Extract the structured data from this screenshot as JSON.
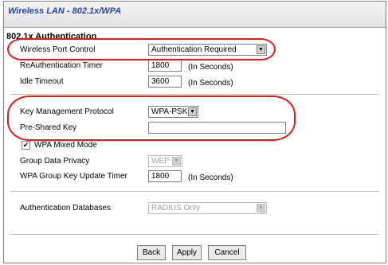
{
  "window": {
    "title": "Wireless LAN - 802.1x/WPA"
  },
  "auth": {
    "heading": "802.1x Authentication",
    "port_control_label": "Wireless Port Control",
    "port_control_value": "Authentication Required",
    "reauth_label": "ReAuthentication Timer",
    "reauth_value": "1800",
    "reauth_unit": "(In Seconds)",
    "idle_label": "Idle Timeout",
    "idle_value": "3600",
    "idle_unit": "(In Seconds)"
  },
  "wpa": {
    "key_mgmt_label": "Key Management Protocol",
    "key_mgmt_value": "WPA-PSK",
    "psk_label": "Pre-Shared Key",
    "psk_value": "",
    "mixed_mode_label": "WPA Mixed Mode",
    "mixed_mode_checked": true,
    "group_privacy_label": "Group Data Privacy",
    "group_privacy_value": "WEP",
    "group_key_label": "WPA Group Key Update Timer",
    "group_key_value": "1800",
    "group_key_unit": "(In Seconds)"
  },
  "database": {
    "label": "Authentication Databases",
    "value": "RADIUS Only"
  },
  "buttons": {
    "back": "Back",
    "apply": "Apply",
    "cancel": "Cancel"
  },
  "colors": {
    "title": "#2a46a6",
    "highlight": "#e81919"
  }
}
